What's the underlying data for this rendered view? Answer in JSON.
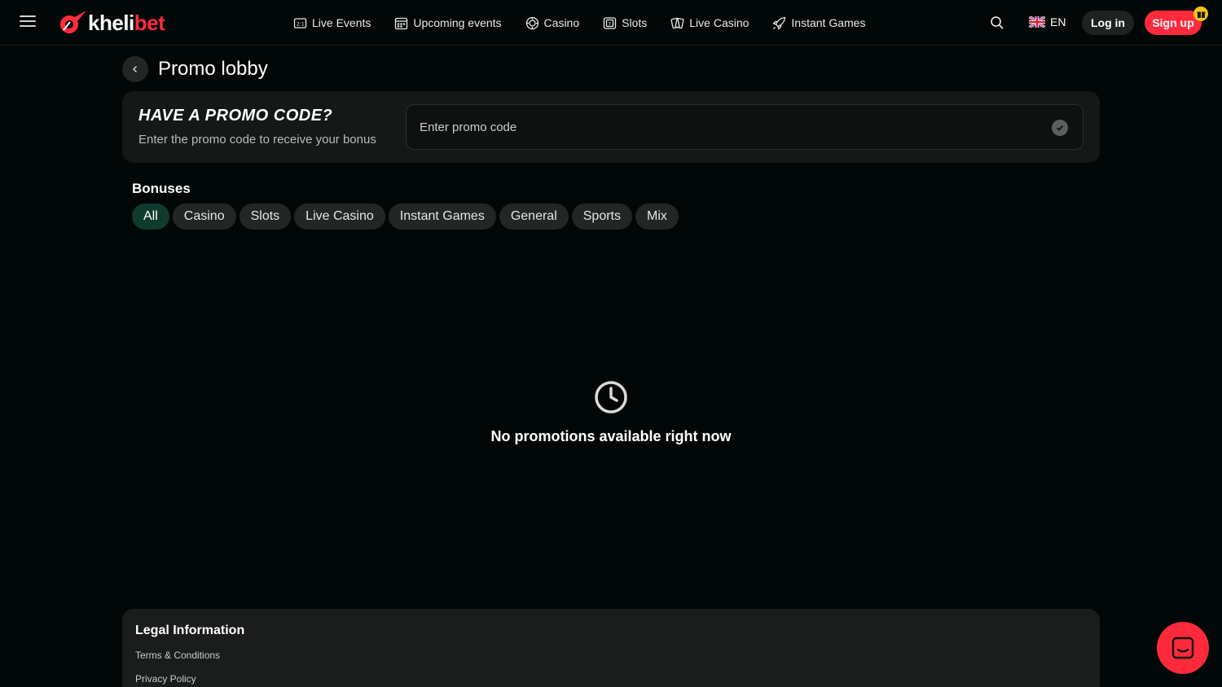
{
  "header": {
    "logo_text_white": "kheli",
    "logo_text_red": "bet",
    "nav": [
      {
        "label": "Live Events",
        "icon": "live-events-icon"
      },
      {
        "label": "Upcoming events",
        "icon": "calendar-icon"
      },
      {
        "label": "Casino",
        "icon": "casino-chip-icon"
      },
      {
        "label": "Slots",
        "icon": "slots-icon"
      },
      {
        "label": "Live Casino",
        "icon": "live-casino-cards-icon"
      },
      {
        "label": "Instant Games",
        "icon": "rocket-icon"
      }
    ],
    "language": "EN",
    "login_label": "Log in",
    "signup_label": "Sign up"
  },
  "page": {
    "title": "Promo lobby"
  },
  "promo": {
    "heading": "HAVE A PROMO CODE?",
    "subtitle": "Enter the promo code to receive your bonus",
    "placeholder": "Enter promo code"
  },
  "bonuses": {
    "title": "Bonuses",
    "filters": [
      "All",
      "Casino",
      "Slots",
      "Live Casino",
      "Instant Games",
      "General",
      "Sports",
      "Mix"
    ],
    "active_filter": "All"
  },
  "empty_state": {
    "message": "No promotions available right now",
    "icon": "clock-icon"
  },
  "footer": {
    "title": "Legal Information",
    "links": [
      "Terms & Conditions",
      "Privacy Policy"
    ]
  },
  "colors": {
    "background": "#020807",
    "accent_red": "#ff2a3c",
    "active_chip": "#0f3a2e"
  }
}
